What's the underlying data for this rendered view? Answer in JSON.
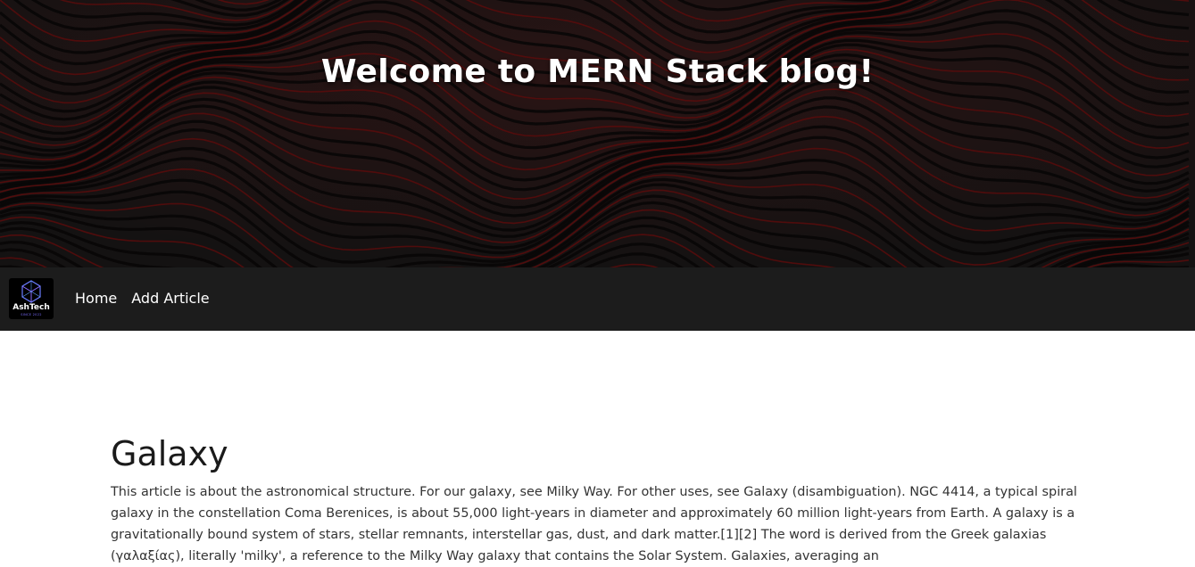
{
  "hero": {
    "title": "Welcome to MERN Stack blog!"
  },
  "navbar": {
    "logo": {
      "name": "AshTech",
      "tagline": "SINCE 2022"
    },
    "links": [
      {
        "label": "Home"
      },
      {
        "label": "Add Article"
      }
    ]
  },
  "article": {
    "title": "Galaxy",
    "body": "This article is about the astronomical structure. For our galaxy, see Milky Way. For other uses, see Galaxy (disambiguation). NGC 4414, a typical spiral galaxy in the constellation Coma Berenices, is about 55,000 light-years in diameter and approximately 60 million light-years from Earth. A galaxy is a gravitationally bound system of stars, stellar remnants, interstellar gas, dust, and dark matter.[1][2] The word is derived from the Greek galaxias (γαλαξίας), literally 'milky', a reference to the Milky Way galaxy that contains the Solar System. Galaxies, averaging an"
  },
  "colors": {
    "hero_background": "#141212",
    "hero_wave_dark": "#070606",
    "hero_wave_red": "#5a0c0c",
    "navbar_background": "#1c1c1c",
    "page_background": "#ffffff",
    "logo_accent": "#7b6cff"
  }
}
